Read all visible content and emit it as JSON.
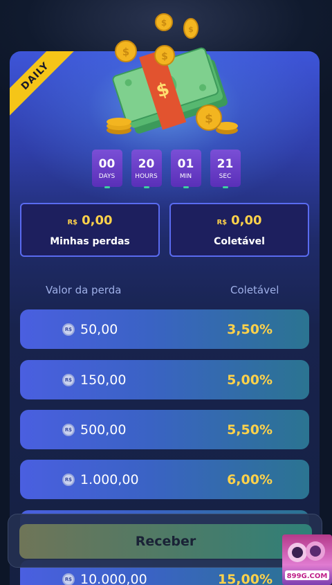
{
  "ribbon": {
    "label": "DAILY"
  },
  "countdown": [
    {
      "value": "00",
      "unit": "DAYS"
    },
    {
      "value": "20",
      "unit": "HOURS"
    },
    {
      "value": "01",
      "unit": "MIN"
    },
    {
      "value": "21",
      "unit": "SEC"
    }
  ],
  "stats": {
    "currency": "R$",
    "losses": {
      "amount": "0,00",
      "label": "Minhas perdas"
    },
    "collectable": {
      "amount": "0,00",
      "label": "Coletável"
    }
  },
  "table": {
    "col_loss": "Valor da perda",
    "col_collectable": "Coletável",
    "coin_symbol": "R$",
    "rows": [
      {
        "loss": "50,00",
        "rate": "3,50%"
      },
      {
        "loss": "150,00",
        "rate": "5,00%"
      },
      {
        "loss": "500,00",
        "rate": "5,50%"
      },
      {
        "loss": "1.000,00",
        "rate": "6,00%"
      },
      {
        "loss": "",
        "rate": ""
      },
      {
        "loss": "10.000,00",
        "rate": "15,00%"
      }
    ]
  },
  "actions": {
    "receive_label": "Receber"
  },
  "brand": {
    "logo_text": "899G.COM"
  },
  "colors": {
    "accent_gold": "#ffd24a",
    "card_top": "#3e55d8",
    "countdown": "#6a3fc8"
  }
}
